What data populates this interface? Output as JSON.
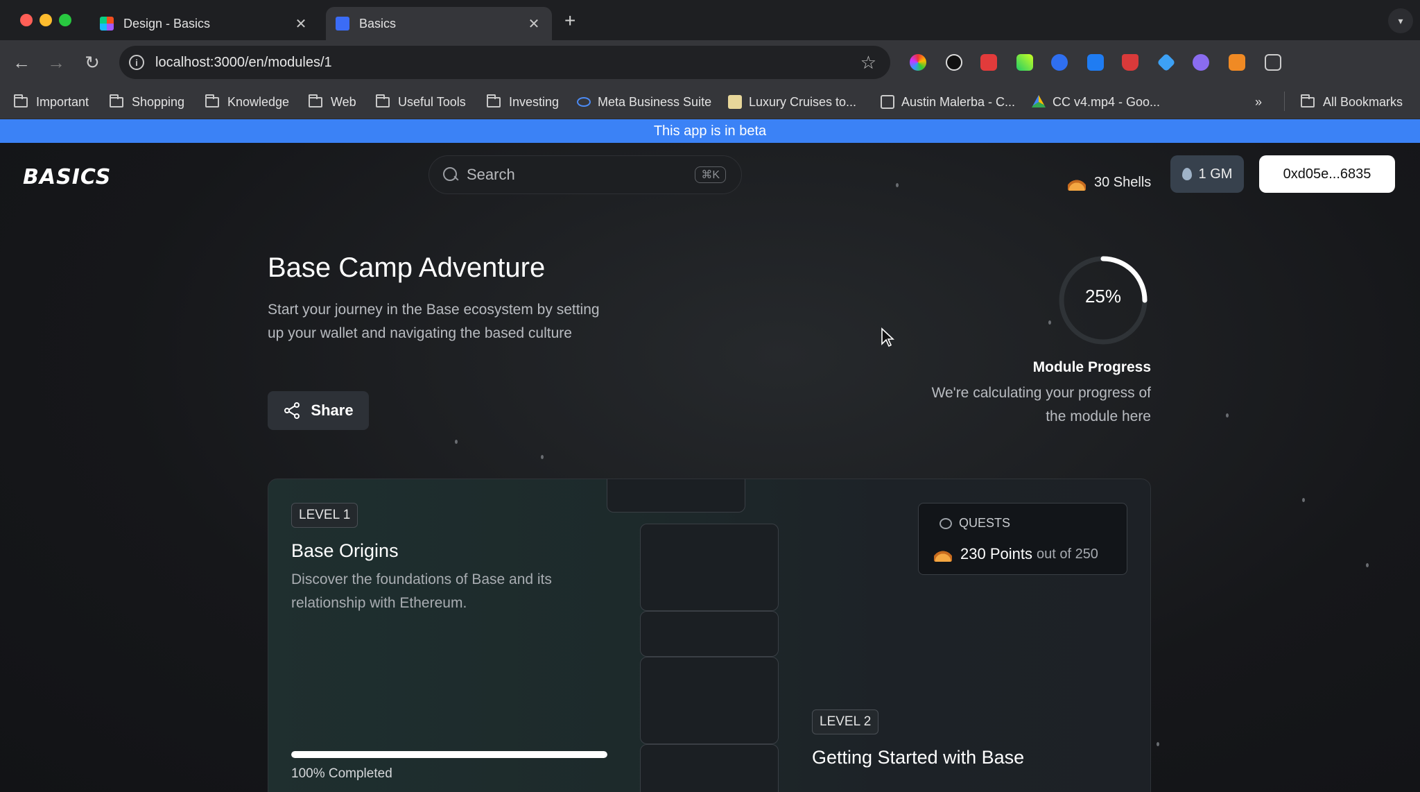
{
  "browser": {
    "tabs": [
      {
        "label": "Design - Basics",
        "close": "✕"
      },
      {
        "label": "Basics",
        "close": "✕"
      }
    ],
    "new_tab": "+",
    "url": "localhost:3000/en/modules/1",
    "bookmarks": [
      "Important",
      "Shopping",
      "Knowledge",
      "Web",
      "Useful Tools",
      "Investing",
      "Meta Business Suite",
      "Luxury Cruises to...",
      "Austin Malerba - C...",
      "CC v4.mp4 - Goo..."
    ],
    "more_bookmarks": "»",
    "all_bookmarks": "All Bookmarks"
  },
  "banner": {
    "text": "This app is in beta",
    "color": "#3b82f6"
  },
  "header": {
    "logo": "BASICS",
    "search": {
      "placeholder": "Search",
      "shortcut": "⌘K"
    },
    "shells": "30 Shells",
    "gm": "1 GM",
    "wallet": "0xd05e...6835"
  },
  "module": {
    "title": "Base Camp Adventure",
    "description": "Start your journey in the Base ecosystem by setting up your wallet and navigating the based culture",
    "share_label": "Share",
    "progress_percent": 25,
    "progress_label": "25%",
    "progress_title": "Module Progress",
    "progress_desc": "We're calculating your progress of the module here"
  },
  "levels": [
    {
      "badge": "LEVEL 1",
      "title": "Base Origins",
      "description": "Discover the foundations of Base and its relationship with Ethereum.",
      "progress": 1.0,
      "progress_label": "100% Completed"
    },
    {
      "badge": "LEVEL 2",
      "title": "Getting Started with Base"
    }
  ],
  "quests": {
    "heading": "QUESTS",
    "points": "230 Points",
    "out_of": "out of 250"
  }
}
